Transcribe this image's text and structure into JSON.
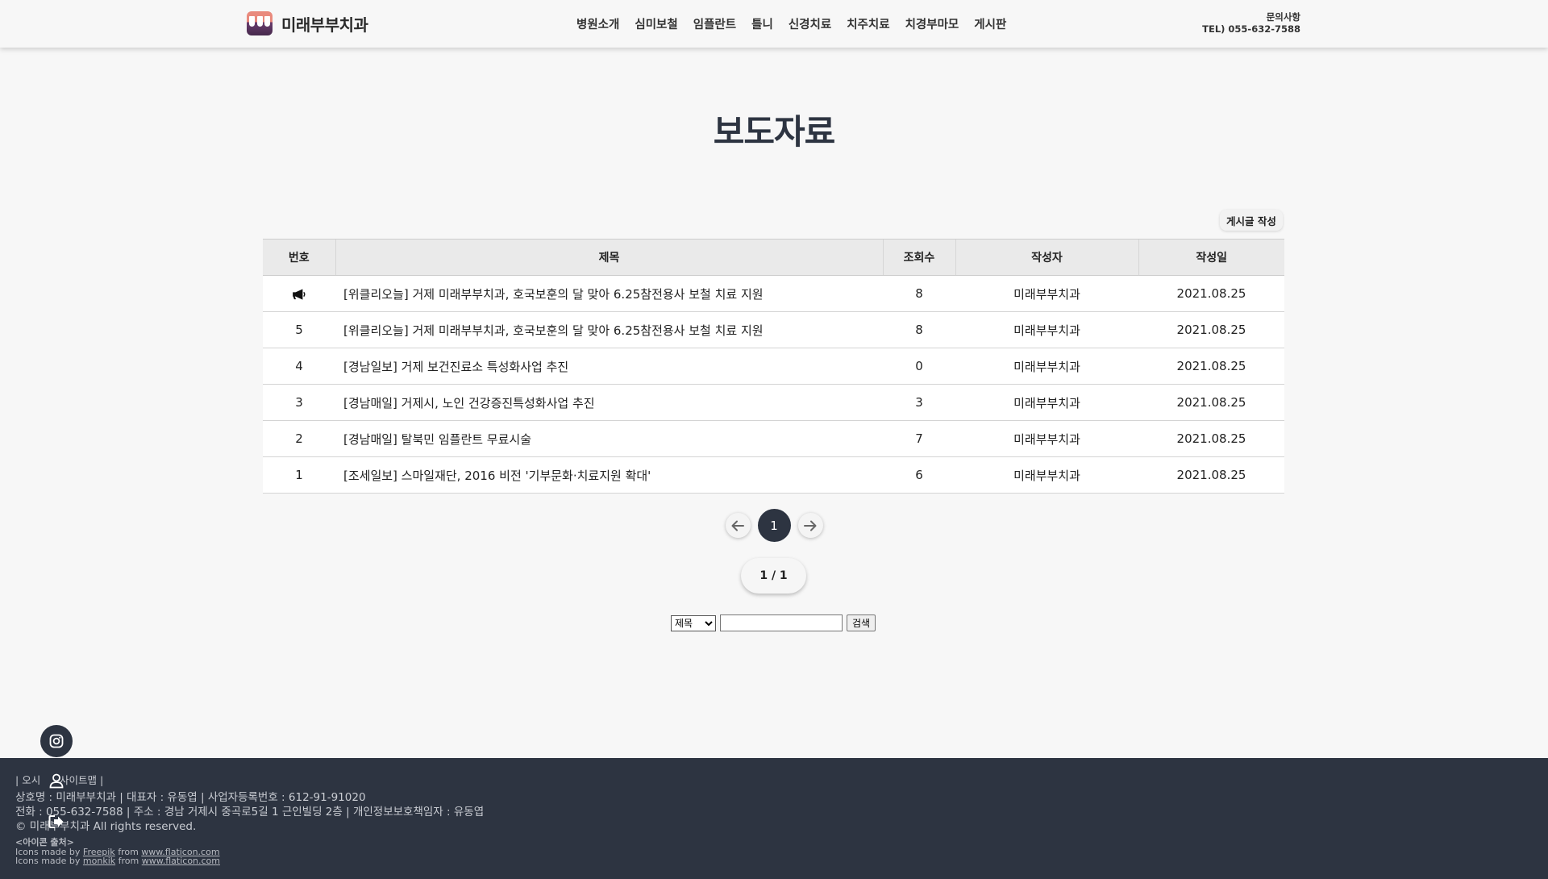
{
  "header": {
    "logo_text": "미래부부치과",
    "nav": [
      "병원소개",
      "심미보철",
      "임플란트",
      "틀니",
      "신경치료",
      "치주치료",
      "치경부마모",
      "게시판"
    ],
    "contact_label": "문의사항",
    "contact_tel": "TEL) 055-632-7588"
  },
  "page_title": "보도자료",
  "write_button": "게시글 작성",
  "table": {
    "headers": [
      "번호",
      "제목",
      "조회수",
      "작성자",
      "작성일"
    ],
    "rows": [
      {
        "no": "",
        "notice": true,
        "title": "[위클리오늘] 거제 미래부부치과, 호국보훈의 달 맞아 6.25참전용사 보철 치료 지원",
        "views": "8",
        "author": "미래부부치과",
        "date": "2021.08.25"
      },
      {
        "no": "5",
        "title": "[위클리오늘] 거제 미래부부치과, 호국보훈의 달 맞아 6.25참전용사 보철 치료 지원",
        "views": "8",
        "author": "미래부부치과",
        "date": "2021.08.25"
      },
      {
        "no": "4",
        "title": "[경남일보] 거제 보건진료소 특성화사업 추진",
        "views": "0",
        "author": "미래부부치과",
        "date": "2021.08.25"
      },
      {
        "no": "3",
        "title": "[경남매일] 거제시, 노인 건강증진특성화사업 추진",
        "views": "3",
        "author": "미래부부치과",
        "date": "2021.08.25"
      },
      {
        "no": "2",
        "title": "[경남매일] 탈북민 임플란트 무료시술",
        "views": "7",
        "author": "미래부부치과",
        "date": "2021.08.25"
      },
      {
        "no": "1",
        "title": "[조세일보] 스마일재단, 2016 비전 '기부문화·치료지원 확대'",
        "views": "6",
        "author": "미래부부치과",
        "date": "2021.08.25"
      }
    ]
  },
  "pagination": {
    "current": "1",
    "summary": "1 / 1"
  },
  "search": {
    "select_value": "제목",
    "button": "검색"
  },
  "footer": {
    "links": [
      "오시",
      "사이트맵"
    ],
    "line1": "상호명 : 미래부부치과 | 대표자 : 유동엽 | 사업자등록번호 : 612-91-91020",
    "line2": "전화 : 055-632-7588 | 주소 : 경남 거제시 중곡로5길 1 근인빌딩 2층 | 개인정보보호책임자 : 유동엽",
    "copyright": "© 미래부부치과 All rights reserved.",
    "credit_title": "<아이콘 출처>",
    "credit_prefix": "Icons made by",
    "credit_from": "from",
    "credit_authors": [
      "Freepik",
      "monkik"
    ],
    "credit_site": "www.flaticon.com"
  },
  "icons": [
    "instagram-icon",
    "user-icon",
    "logout-icon",
    "megaphone-icon",
    "arrow-left-icon",
    "arrow-right-icon"
  ],
  "colors": {
    "primary_dark": "#2d3441",
    "background": "#f7f7f7"
  }
}
